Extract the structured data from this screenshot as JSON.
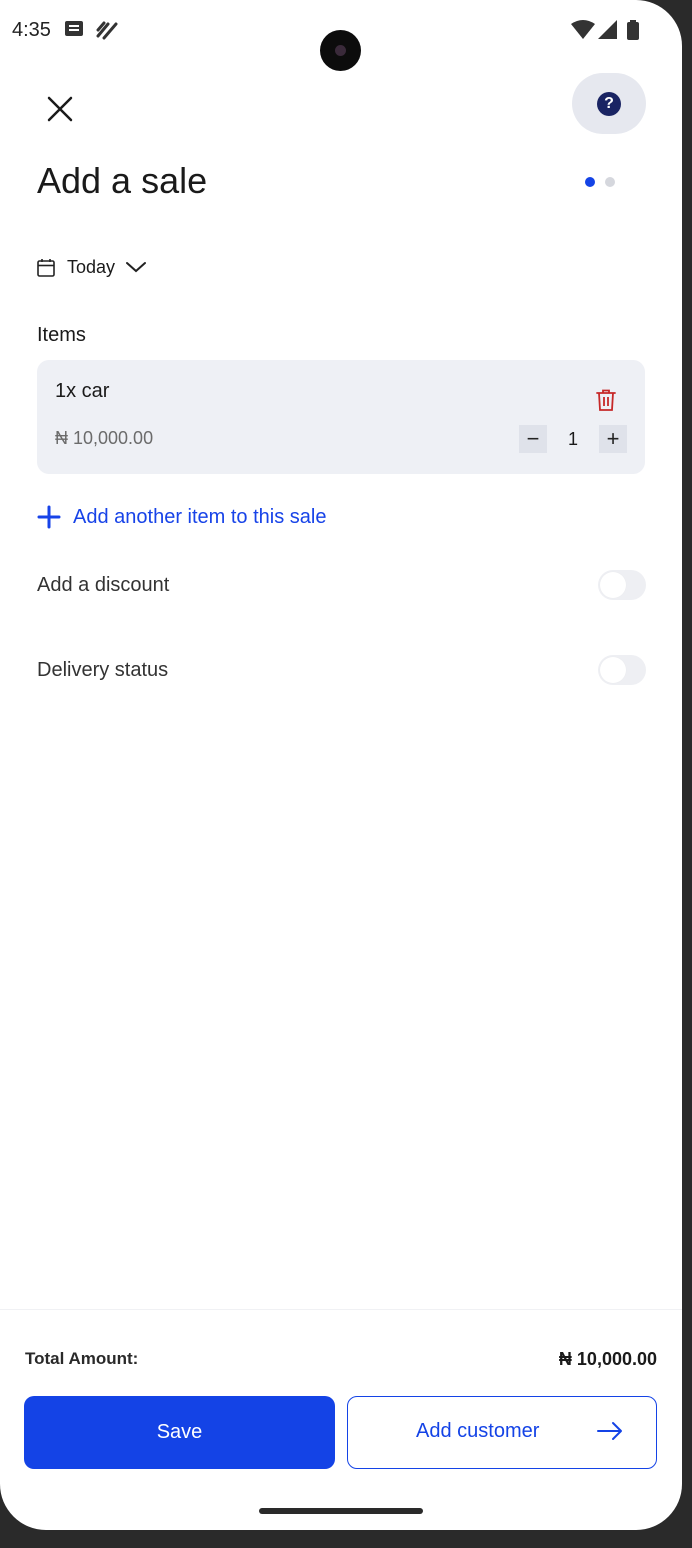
{
  "status_bar": {
    "time": "4:35",
    "icons": [
      "message-icon",
      "sync-icon",
      "wifi-icon",
      "signal-icon",
      "battery-icon"
    ]
  },
  "header": {
    "close_icon": "close-icon",
    "help_icon": "help-icon",
    "help_label": "?",
    "title": "Add a sale",
    "step_indicator": {
      "current": 1,
      "total": 2
    }
  },
  "date_picker": {
    "icon": "calendar-icon",
    "label": "Today",
    "chevron_icon": "chevron-down-icon"
  },
  "items_section": {
    "label": "Items",
    "items": [
      {
        "name": "1x car",
        "price": "₦ 10,000.00",
        "quantity": "1"
      }
    ],
    "stepper": {
      "minus": "−",
      "plus": "+"
    }
  },
  "add_item": {
    "label": "Add another item to this sale",
    "icon": "plus-icon"
  },
  "toggles": [
    {
      "label": "Add a discount",
      "on": false
    },
    {
      "label": "Delivery status",
      "on": false
    }
  ],
  "footer": {
    "total_label": "Total Amount:",
    "total_value": "₦ 10,000.00",
    "save_label": "Save",
    "add_customer_label": "Add customer",
    "arrow_icon": "arrow-right-icon"
  },
  "colors": {
    "accent": "#1443e6",
    "delete": "#c62828",
    "card_bg": "#eef0f5"
  }
}
